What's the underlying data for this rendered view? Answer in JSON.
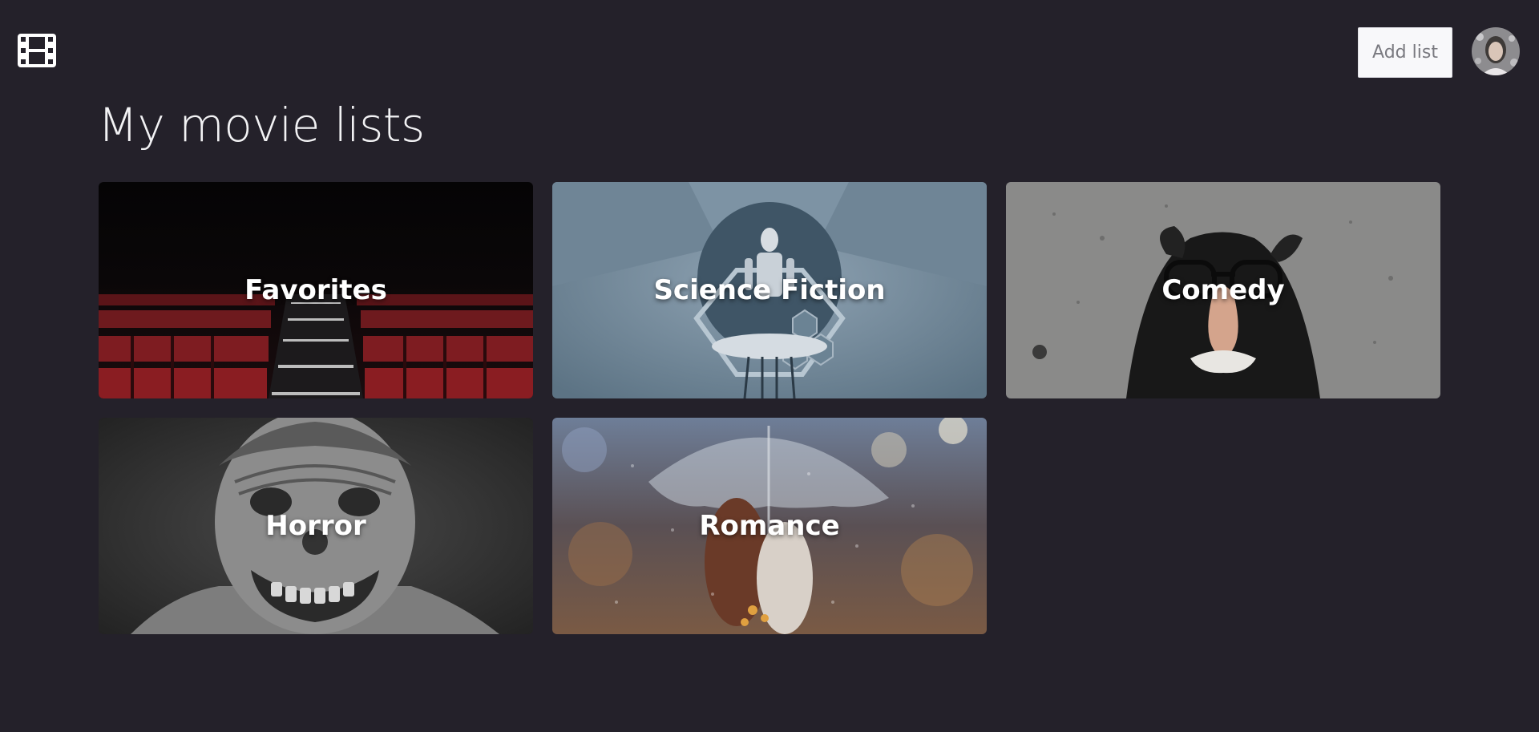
{
  "header": {
    "logo_icon": "film-icon",
    "add_list_label": "Add list",
    "avatar_icon": "user-avatar"
  },
  "main": {
    "title": "My movie lists",
    "lists": [
      {
        "label": "Favorites"
      },
      {
        "label": "Science Fiction"
      },
      {
        "label": "Comedy"
      },
      {
        "label": "Horror"
      },
      {
        "label": "Romance"
      }
    ]
  },
  "colors": {
    "background": "#24212a",
    "button_bg": "#f8f8fa",
    "title_text": "#f2f2f4",
    "card_text": "#ffffff"
  }
}
